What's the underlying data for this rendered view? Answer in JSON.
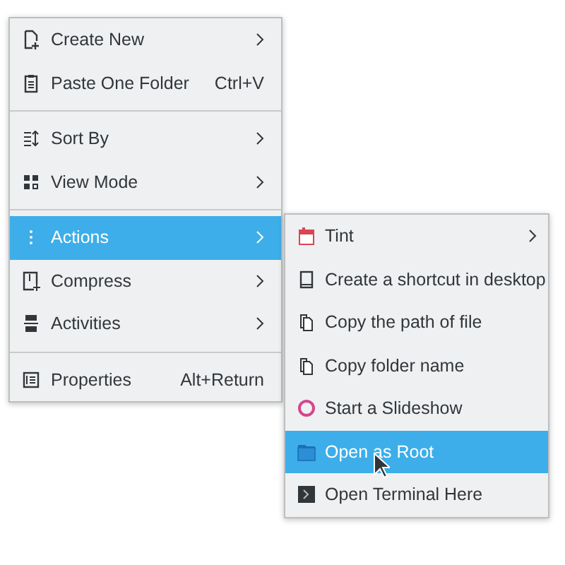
{
  "context_menu": {
    "sections": [
      [
        {
          "label": "Create New",
          "submenu": true,
          "selected": false
        },
        {
          "label": "Paste One Folder",
          "shortcut": "Ctrl+V",
          "submenu": false,
          "selected": false
        }
      ],
      [
        {
          "label": "Sort By",
          "submenu": true,
          "selected": false
        },
        {
          "label": "View Mode",
          "submenu": true,
          "selected": false
        }
      ],
      [
        {
          "label": "Actions",
          "submenu": true,
          "selected": true
        },
        {
          "label": "Compress",
          "submenu": true,
          "selected": false
        },
        {
          "label": "Activities",
          "submenu": true,
          "selected": false
        }
      ],
      [
        {
          "label": "Properties",
          "shortcut": "Alt+Return",
          "submenu": false,
          "selected": false
        }
      ]
    ]
  },
  "actions_submenu": {
    "items": [
      {
        "label": "Tint",
        "submenu": true,
        "selected": false
      },
      {
        "label": "Create a shortcut in desktop",
        "submenu": false,
        "selected": false
      },
      {
        "label": "Copy the path of file",
        "submenu": false,
        "selected": false
      },
      {
        "label": "Copy folder name",
        "submenu": false,
        "selected": false
      },
      {
        "label": "Start a Slideshow",
        "submenu": false,
        "selected": false
      },
      {
        "label": "Open as Root",
        "submenu": false,
        "selected": true
      },
      {
        "label": "Open Terminal Here",
        "submenu": false,
        "selected": false
      }
    ]
  }
}
